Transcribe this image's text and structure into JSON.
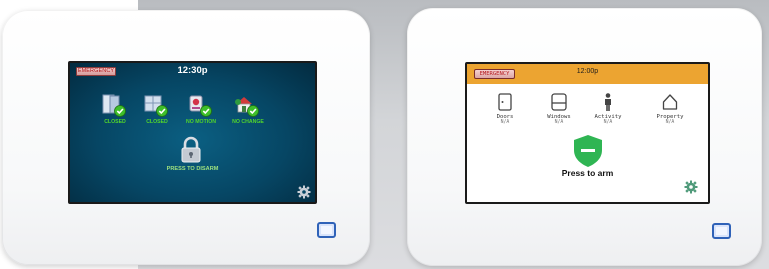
{
  "left_panel": {
    "emergency_label": "EMERGENCY",
    "time": "12:30p",
    "statuses": [
      {
        "label": "CLOSED",
        "icon": "doors-icon"
      },
      {
        "label": "CLOSED",
        "icon": "windows-icon"
      },
      {
        "label": "NO MOTION",
        "icon": "motion-sensor-icon"
      },
      {
        "label": "NO CHANGE",
        "icon": "property-icon"
      }
    ],
    "action": "PRESS TO DISARM",
    "settings_icon": "gear-icon",
    "colors": {
      "screen": "#064664",
      "status_text": "#53d62b",
      "check": "#3fbf2a"
    }
  },
  "right_panel": {
    "emergency_label": "EMERGENCY",
    "time": "12:00p",
    "statuses": [
      {
        "name": "Doors",
        "value": "N/A",
        "icon": "door-icon"
      },
      {
        "name": "Windows",
        "value": "N/A",
        "icon": "window-icon"
      },
      {
        "name": "Activity",
        "value": "N/A",
        "icon": "person-icon"
      },
      {
        "name": "Property",
        "value": "N/A",
        "icon": "house-icon"
      }
    ],
    "action": "Press to arm",
    "settings_icon": "gear-icon",
    "colors": {
      "header": "#eca431",
      "shield": "#2fb553"
    }
  }
}
